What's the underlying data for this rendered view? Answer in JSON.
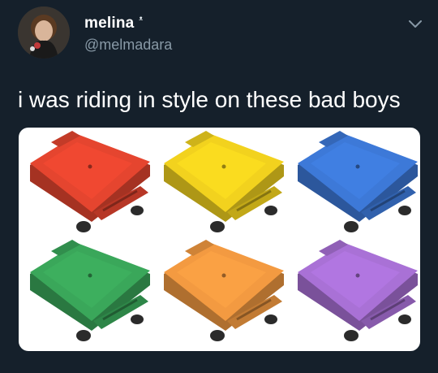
{
  "user": {
    "display_name": "melina",
    "handle": "@melmadara",
    "emoji": "ᵜ"
  },
  "tweet": {
    "text": "i was riding in style on these bad boys"
  },
  "icons": {
    "menu": "chevron-down-icon",
    "avatar": "avatar"
  },
  "media": {
    "scooter_colors": [
      "#e5452f",
      "#f2d21e",
      "#3d79d8",
      "#3aa75a",
      "#f39a41",
      "#a971d6"
    ]
  },
  "colors": {
    "background": "#15202b",
    "secondary_text": "#8899a6"
  }
}
